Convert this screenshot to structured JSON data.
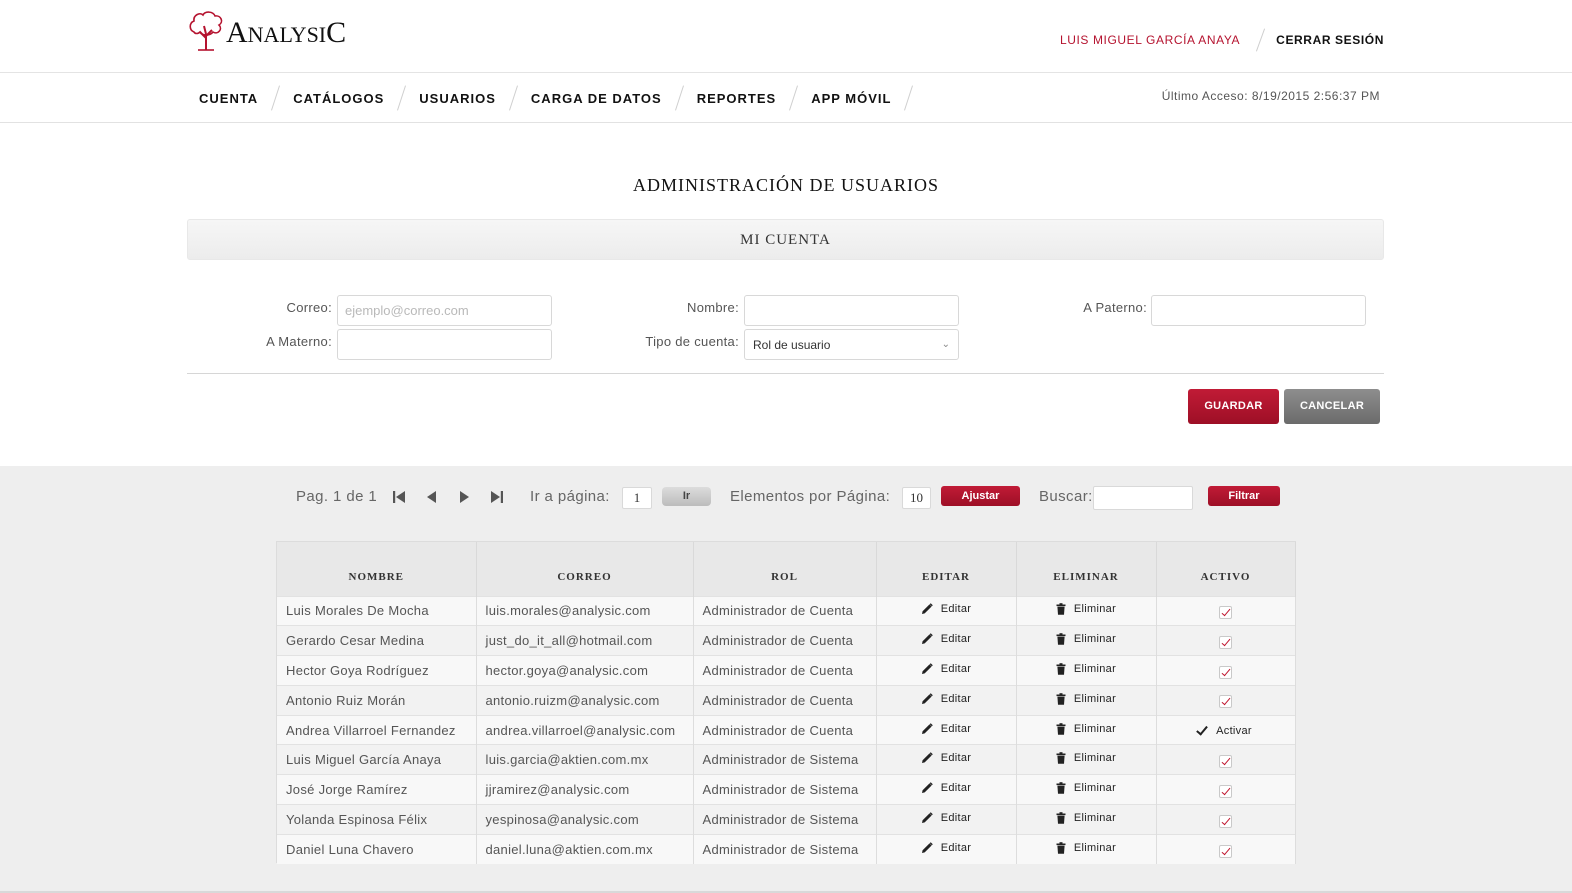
{
  "header": {
    "logo_text_main": "A",
    "logo_text_rest": "NALYSI",
    "logo_text_end": "C",
    "user_name": "LUIS MIGUEL GARCÍA ANAYA",
    "logout_label": "CERRAR SESIÓN"
  },
  "nav": {
    "items": [
      "CUENTA",
      "CATÁLOGOS",
      "USUARIOS",
      "CARGA DE DATOS",
      "REPORTES",
      "APP MÓVIL"
    ],
    "last_access": "Último Acceso: 8/19/2015 2:56:37 PM"
  },
  "page": {
    "title": "ADMINISTRACIÓN DE USUARIOS",
    "section_title": "MI CUENTA"
  },
  "form": {
    "correo_label": "Correo:",
    "correo_placeholder": "ejemplo@correo.com",
    "nombre_label": "Nombre:",
    "apaterno_label": "A Paterno:",
    "amaterno_label": "A Materno:",
    "tipo_label": "Tipo de cuenta:",
    "tipo_value": "Rol de usuario",
    "save_label": "GUARDAR",
    "cancel_label": "CANCELAR"
  },
  "pager": {
    "page_text": "Pag. 1 de 1",
    "goto_label": "Ir a página:",
    "goto_value": "1",
    "goto_button": "Ir",
    "per_page_label": "Elementos por Página:",
    "per_page_value": "10",
    "adjust_button": "Ajustar",
    "search_label": "Buscar:",
    "filter_button": "Filtrar"
  },
  "table": {
    "columns": [
      "NOMBRE",
      "CORREO",
      "ROL",
      "EDITAR",
      "ELIMINAR",
      "ACTIVO"
    ],
    "edit_label": "Editar",
    "delete_label": "Eliminar",
    "activate_label": "Activar",
    "rows": [
      {
        "nombre": "Luis Morales De Mocha",
        "correo": "luis.morales@analysic.com",
        "rol": "Administrador de Cuenta",
        "activo": true
      },
      {
        "nombre": "Gerardo Cesar Medina",
        "correo": "just_do_it_all@hotmail.com",
        "rol": "Administrador de Cuenta",
        "activo": true
      },
      {
        "nombre": "Hector Goya Rodríguez",
        "correo": "hector.goya@analysic.com",
        "rol": "Administrador de Cuenta",
        "activo": true
      },
      {
        "nombre": "Antonio Ruiz Morán",
        "correo": "antonio.ruizm@analysic.com",
        "rol": "Administrador de Cuenta",
        "activo": true
      },
      {
        "nombre": "Andrea Villarroel Fernandez",
        "correo": "andrea.villarroel@analysic.com",
        "rol": "Administrador de Cuenta",
        "activo": false
      },
      {
        "nombre": "Luis Miguel García Anaya",
        "correo": "luis.garcia@aktien.com.mx",
        "rol": "Administrador de Sistema",
        "activo": true
      },
      {
        "nombre": "José Jorge Ramírez",
        "correo": "jjramirez@analysic.com",
        "rol": "Administrador de Sistema",
        "activo": true
      },
      {
        "nombre": "Yolanda Espinosa Félix",
        "correo": "yespinosa@analysic.com",
        "rol": "Administrador de Sistema",
        "activo": true
      },
      {
        "nombre": "Daniel Luna Chavero",
        "correo": "daniel.luna@aktien.com.mx",
        "rol": "Administrador de Sistema",
        "activo": true
      }
    ]
  },
  "colors": {
    "brand_red": "#b5132f",
    "button_gray": "#7d7d7d"
  }
}
